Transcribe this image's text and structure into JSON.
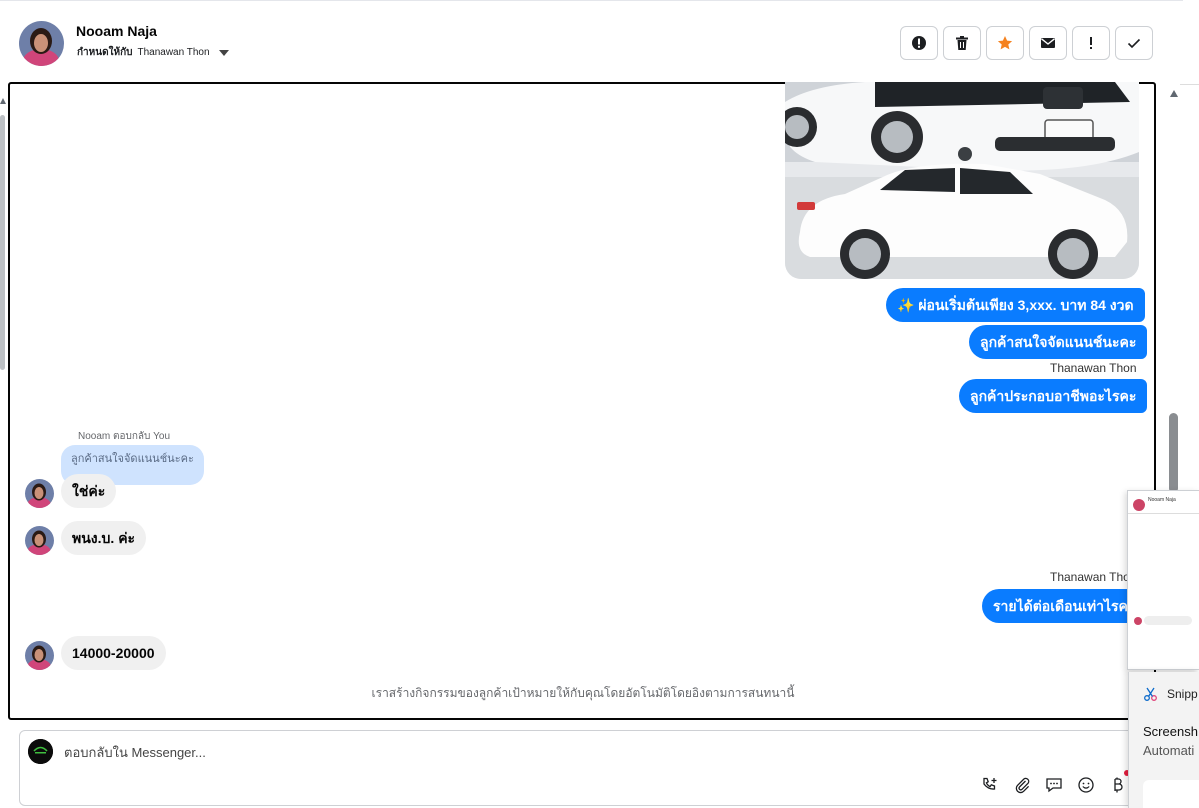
{
  "header": {
    "contact_name": "Nooam Naja",
    "assign_prefix": "กำหนดให้กับ",
    "assignee": "Thanawan Thon",
    "toolbar": [
      {
        "name": "spam-icon",
        "label": ""
      },
      {
        "name": "trash-icon",
        "label": ""
      },
      {
        "name": "star-icon",
        "label": ""
      },
      {
        "name": "envelope-icon",
        "label": ""
      },
      {
        "name": "exclamation-icon",
        "label": ""
      },
      {
        "name": "checkmark-icon",
        "label": ""
      }
    ]
  },
  "messages": {
    "out_1": "✨ ผ่อนเริ่มต้นเพียง 3,xxx. บาท 84 งวด",
    "out_2": "ลูกค้าสนใจจัดแนนช์นะคะ",
    "sender_1": "Thanawan Thon",
    "out_3": "ลูกค้าประกอบอาชีพอะไรคะ",
    "reply_label": "Nooam ตอบกลับ You",
    "reply_quote": "ลูกค้าสนใจจัดแนนช์นะคะ",
    "in_1": "ใช่ค่ะ",
    "in_2": "พนง.บ. ค่ะ",
    "sender_2": "Thanawan Thon",
    "out_4": "รายได้ต่อเดือนเท่าไรคะ",
    "in_3": "14000-20000",
    "footer_note": "เราสร้างกิจกรรมของลูกค้าเป้าหมายให้กับคุณโดยอัตโนมัติโดยอิงตามการสนทนานี้"
  },
  "composer": {
    "placeholder": "ตอบกลับใน Messenger..."
  },
  "overlay": {
    "mini_name": "Nooam Naja",
    "snip_app": "Snipp",
    "title": "Screensh",
    "subtitle": "Automati"
  },
  "colors": {
    "outgoing_bubble": "#0a7cff",
    "incoming_bubble": "#f0f0f0",
    "star": "#f5821f"
  }
}
